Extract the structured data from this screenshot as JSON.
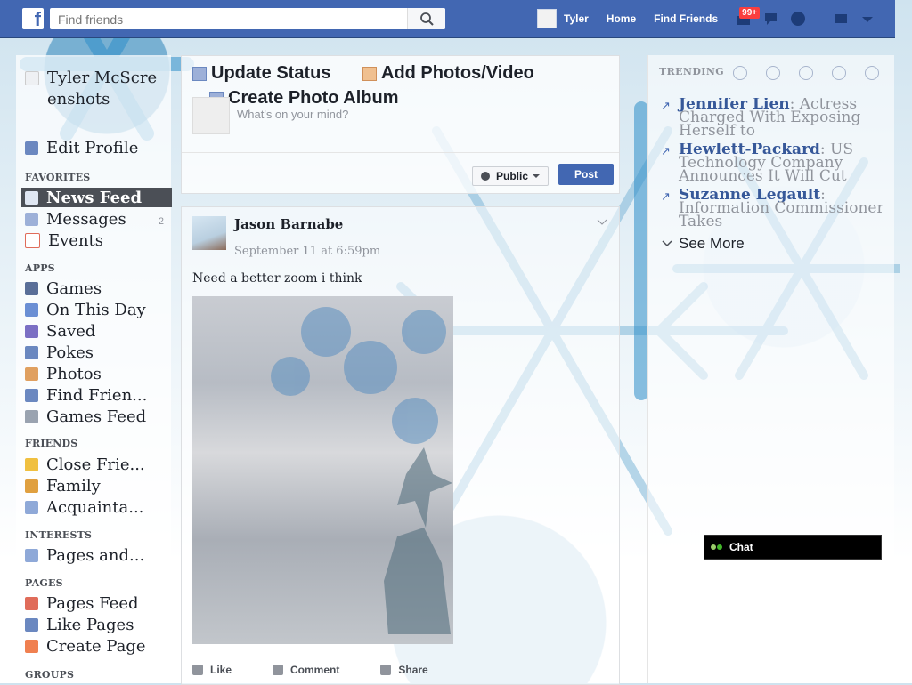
{
  "topbar": {
    "logo": "f",
    "search_placeholder": "Find friends",
    "user_name": "Tyler",
    "home": "Home",
    "find_friends": "Find Friends",
    "notifications_badge": "99+"
  },
  "left_nav": {
    "profile_name": "Tyler McScreenshots",
    "edit_profile": "Edit Profile",
    "favorites_header": "FAVORITES",
    "favorites": [
      {
        "label": "News Feed",
        "icon": "news-feed-icon"
      },
      {
        "label": "Messages",
        "icon": "messages-icon",
        "count": "2"
      },
      {
        "label": "Events",
        "icon": "events-icon"
      }
    ],
    "apps_header": "APPS",
    "apps": [
      {
        "label": "Games",
        "icon": "games-icon"
      },
      {
        "label": "On This Day",
        "icon": "on-this-day-icon"
      },
      {
        "label": "Saved",
        "icon": "saved-icon"
      },
      {
        "label": "Pokes",
        "icon": "pokes-icon"
      },
      {
        "label": "Photos",
        "icon": "photos-icon"
      },
      {
        "label": "Find Frien...",
        "icon": "find-friends-icon"
      },
      {
        "label": "Games Feed",
        "icon": "games-feed-icon"
      }
    ],
    "friends_header": "FRIENDS",
    "friends": [
      {
        "label": "Close Frie...",
        "icon": "star-icon"
      },
      {
        "label": "Family",
        "icon": "family-icon"
      },
      {
        "label": "Acquainta...",
        "icon": "acquaintances-icon"
      }
    ],
    "interests_header": "INTERESTS",
    "interests": [
      {
        "label": "Pages and...",
        "icon": "pages-icon"
      }
    ],
    "pages_header": "PAGES",
    "pages": [
      {
        "label": "Pages Feed",
        "icon": "pages-feed-icon"
      },
      {
        "label": "Like Pages",
        "icon": "like-pages-icon"
      },
      {
        "label": "Create Page",
        "icon": "create-page-icon"
      }
    ],
    "groups_header": "GROUPS"
  },
  "composer": {
    "update_status": "Update Status",
    "add_photos": "Add Photos/Video",
    "create_album": "Create Photo Album",
    "placeholder": "What's on your mind?",
    "privacy": "Public",
    "post": "Post"
  },
  "story": {
    "author": "Jason Barnabe",
    "time": "September 11 at 6:59pm",
    "text": "Need a better zoom i think",
    "actions": [
      "Like",
      "Comment",
      "Share"
    ]
  },
  "trending": {
    "header": "TRENDING",
    "items": [
      {
        "name": "Jennifer Lien",
        "desc": ": Actress Charged With Exposing Herself to"
      },
      {
        "name": "Hewlett-Packard",
        "desc": ": US Technology Company Announces It Will Cut"
      },
      {
        "name": "Suzanne Legault",
        "desc": ": Information Commissioner Takes"
      }
    ],
    "see_more": "See More"
  },
  "chat": {
    "label": "Chat"
  },
  "colors": {
    "brand": "#4267b2",
    "badge": "#fa3e3e"
  }
}
